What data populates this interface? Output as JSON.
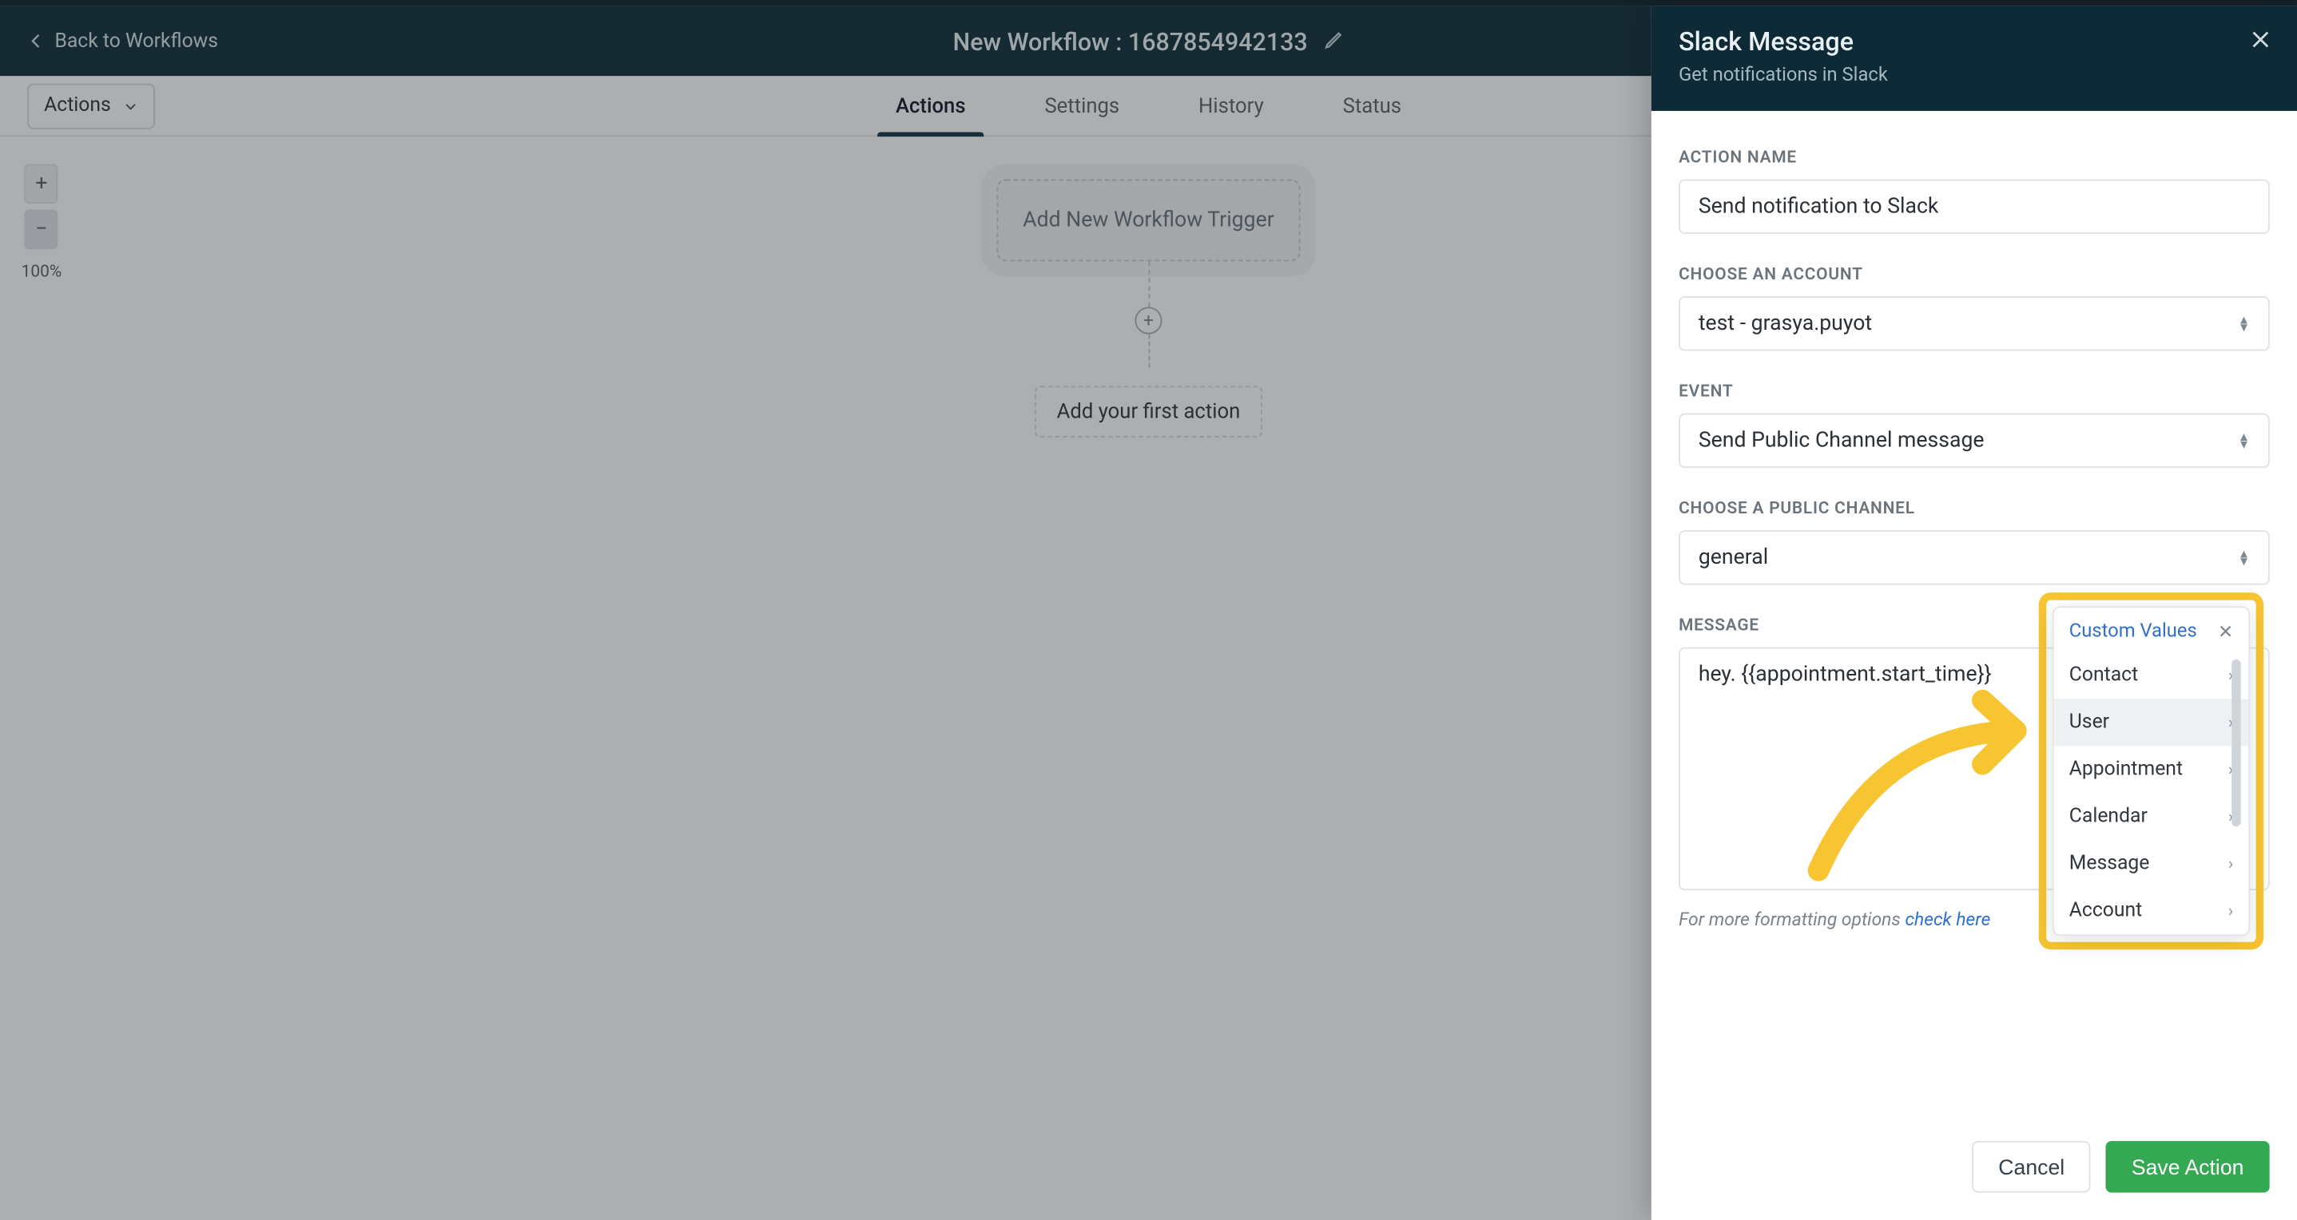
{
  "header": {
    "back_label": "Back to Workflows",
    "title": "New Workflow : 1687854942133"
  },
  "tabs": {
    "actions": "Actions",
    "settings": "Settings",
    "history": "History",
    "status": "Status",
    "actions_dropdown": "Actions"
  },
  "canvas": {
    "zoom_label": "100%",
    "trigger_card": "Add New Workflow Trigger",
    "first_action": "Add your first action"
  },
  "panel": {
    "title": "Slack Message",
    "subtitle": "Get notifications in Slack",
    "action_name_label": "ACTION NAME",
    "action_name_value": "Send notification to Slack",
    "account_label": "CHOOSE AN ACCOUNT",
    "account_value": "test - grasya.puyot",
    "event_label": "EVENT",
    "event_value": "Send Public Channel message",
    "channel_label": "CHOOSE A PUBLIC CHANNEL",
    "channel_value": "general",
    "message_label": "MESSAGE",
    "message_value": "hey. {{appointment.start_time}}",
    "hint_text": "For more formatting options ",
    "hint_link": "check here",
    "cancel": "Cancel",
    "save": "Save Action"
  },
  "popover": {
    "title": "Custom Values",
    "items": [
      "Contact",
      "User",
      "Appointment",
      "Calendar",
      "Message",
      "Account"
    ],
    "hover_index": 1
  }
}
